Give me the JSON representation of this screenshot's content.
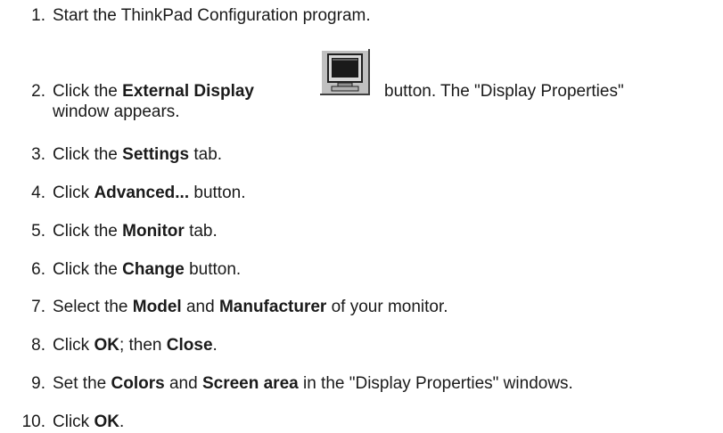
{
  "steps": [
    {
      "num": "1.",
      "parts": [
        {
          "t": "Start the ThinkPad Configuration program.",
          "b": false
        }
      ]
    },
    {
      "num": "2.",
      "parts": [
        {
          "t": "Click the ",
          "b": false
        },
        {
          "t": "External Display",
          "b": true
        }
      ],
      "after_icon": "button. The \"Display Properties\"",
      "line2": "window appears.",
      "icon": "monitor-icon"
    },
    {
      "num": "3.",
      "parts": [
        {
          "t": "Click the ",
          "b": false
        },
        {
          "t": "Settings",
          "b": true
        },
        {
          "t": " tab.",
          "b": false
        }
      ]
    },
    {
      "num": "4.",
      "parts": [
        {
          "t": "Click ",
          "b": false
        },
        {
          "t": "Advanced...",
          "b": true
        },
        {
          "t": " button.",
          "b": false
        }
      ]
    },
    {
      "num": "5.",
      "parts": [
        {
          "t": "Click the ",
          "b": false
        },
        {
          "t": "Monitor",
          "b": true
        },
        {
          "t": " tab.",
          "b": false
        }
      ]
    },
    {
      "num": "6.",
      "parts": [
        {
          "t": "Click the ",
          "b": false
        },
        {
          "t": "Change",
          "b": true
        },
        {
          "t": " button.",
          "b": false
        }
      ]
    },
    {
      "num": "7.",
      "parts": [
        {
          "t": "Select the ",
          "b": false
        },
        {
          "t": "Model",
          "b": true
        },
        {
          "t": " and ",
          "b": false
        },
        {
          "t": "Manufacturer",
          "b": true
        },
        {
          "t": " of your monitor.",
          "b": false
        }
      ]
    },
    {
      "num": "8.",
      "parts": [
        {
          "t": "Click ",
          "b": false
        },
        {
          "t": "OK",
          "b": true
        },
        {
          "t": "; then ",
          "b": false
        },
        {
          "t": "Close",
          "b": true
        },
        {
          "t": ".",
          "b": false
        }
      ]
    },
    {
      "num": "9.",
      "parts": [
        {
          "t": "Set the ",
          "b": false
        },
        {
          "t": "Colors",
          "b": true
        },
        {
          "t": " and ",
          "b": false
        },
        {
          "t": "Screen area",
          "b": true
        },
        {
          "t": " in the \"Display Properties\" windows.",
          "b": false
        }
      ]
    },
    {
      "num": "10.",
      "parts": [
        {
          "t": "Click ",
          "b": false
        },
        {
          "t": "OK",
          "b": true
        },
        {
          "t": ".",
          "b": false
        }
      ]
    }
  ]
}
